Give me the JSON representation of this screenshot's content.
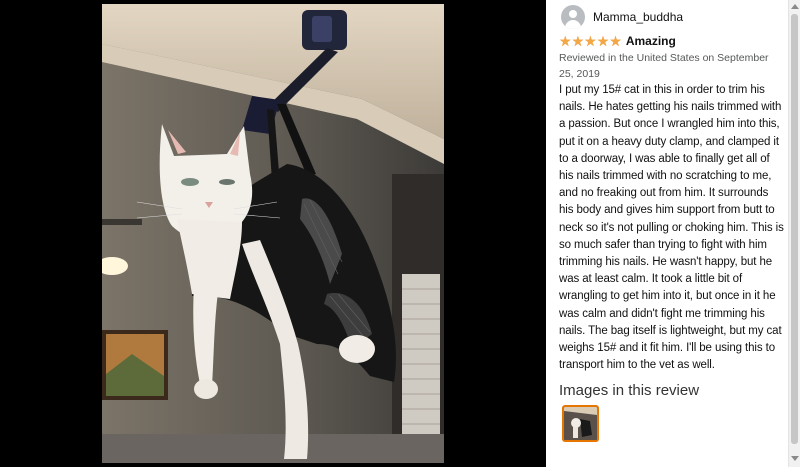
{
  "viewer": {
    "image_alt": "Customer image"
  },
  "review": {
    "username": "Mamma_buddha",
    "stars": 5,
    "star_glyphs": [
      "★",
      "★",
      "★",
      "★",
      "★"
    ],
    "title": "Amazing",
    "meta": "Reviewed in the United States on September 25, 2019",
    "body": "I put my 15# cat in this in order to trim his nails. He hates getting his nails trimmed with a passion. But once I wrangled him into this, put it on a heavy duty clamp, and clamped it to a doorway, I was able to finally get all of his nails trimmed with no scratching to me, and no freaking out from him. It surrounds his body and gives him support from butt to neck so it's not pulling or choking him. This is so much safer than trying to fight with him trimming his nails. He wasn't happy, but he was at least calm. It took a little bit of wrangling to get him into it, but once in it he was calm and didn't fight me trimming his nails. The bag itself is lightweight, but my cat weighs 15# and it fit him. I'll be using this to transport him to the vet as well."
  },
  "images_section": {
    "heading": "Images in this review"
  },
  "colors": {
    "star": "#f3a847",
    "thumb_border": "#e77600",
    "viewer_bg": "#000000"
  }
}
